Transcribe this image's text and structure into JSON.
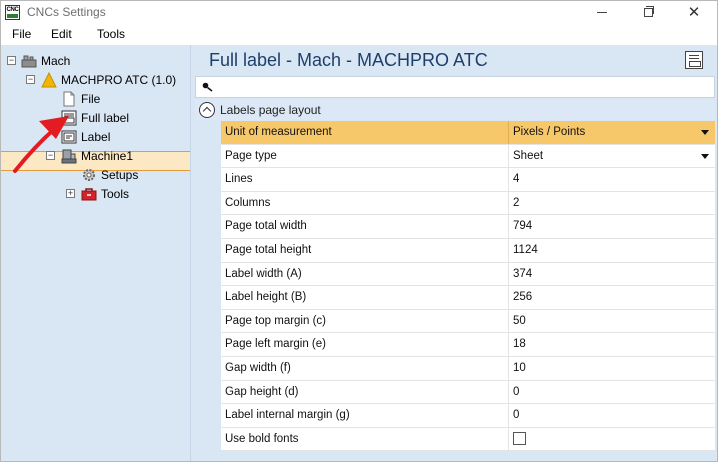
{
  "window": {
    "app_icon_text": "CNC",
    "title": "CNCs Settings"
  },
  "menu": {
    "file": "File",
    "edit": "Edit",
    "tools": "Tools"
  },
  "tree": {
    "root": "Mach",
    "machine": "MACHPRO ATC (1.0)",
    "file": "File",
    "full_label": "Full label",
    "label": "Label",
    "machine1": "Machine1",
    "setups": "Setups",
    "tools": "Tools"
  },
  "content": {
    "title": "Full label - Mach - MACHPRO ATC",
    "search_placeholder": "",
    "group_title": "Labels page layout"
  },
  "properties": [
    {
      "label": "Unit of measurement",
      "value": "Pixels / Points",
      "type": "dropdown",
      "highlight": true
    },
    {
      "label": "Page type",
      "value": "Sheet",
      "type": "dropdown",
      "highlight": false
    },
    {
      "label": "Lines",
      "value": "4",
      "type": "text"
    },
    {
      "label": "Columns",
      "value": "2",
      "type": "text"
    },
    {
      "label": "Page total width",
      "value": "794",
      "type": "text"
    },
    {
      "label": "Page total height",
      "value": "1124",
      "type": "text"
    },
    {
      "label": "Label width (A)",
      "value": "374",
      "type": "text"
    },
    {
      "label": "Label height (B)",
      "value": "256",
      "type": "text"
    },
    {
      "label": "Page top margin (c)",
      "value": "50",
      "type": "text"
    },
    {
      "label": "Page left margin (e)",
      "value": "18",
      "type": "text"
    },
    {
      "label": "Gap width (f)",
      "value": "10",
      "type": "text"
    },
    {
      "label": "Gap height (d)",
      "value": "0",
      "type": "text"
    },
    {
      "label": "Label internal margin (g)",
      "value": "0",
      "type": "text"
    },
    {
      "label": "Use bold fonts",
      "value": "",
      "type": "checkbox",
      "checked": false
    }
  ],
  "colors": {
    "panel_bg": "#d9e6f4",
    "selected_bg": "#fde8c4",
    "selected_border": "#e69c3c",
    "highlight_row": "#f7c86a",
    "title_color": "#1f3f6b",
    "annotation_arrow": "#e31b23"
  },
  "icons": {
    "root": "machine-group-icon",
    "machine": "warning-triangle-icon",
    "file": "document-icon",
    "full_label": "full-label-icon",
    "label": "label-icon",
    "machine1": "cnc-machine-icon",
    "setups": "gear-icon",
    "tools": "toolbox-icon"
  }
}
